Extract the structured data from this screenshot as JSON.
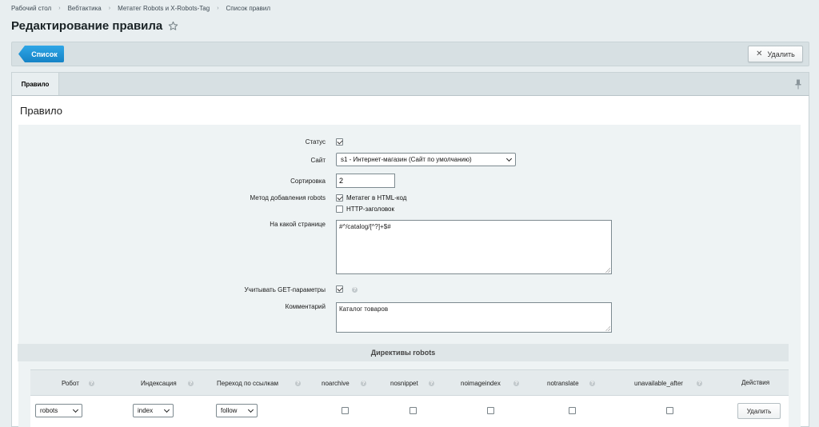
{
  "breadcrumb": [
    "Рабочий стол",
    "Вебтактика",
    "Метатег Robots и X-Robots-Tag",
    "Список правил"
  ],
  "page_title": "Редактирование правила",
  "toolbar": {
    "list_label": "Список",
    "delete_label": "Удалить"
  },
  "tabs": [
    {
      "label": "Правило",
      "active": true
    }
  ],
  "section_heading": "Правило",
  "form": {
    "status_label": "Статус",
    "status_checked": true,
    "site_label": "Сайт",
    "site_value": "s1 - Интернет-магазин (Сайт по умолчанию)",
    "sort_label": "Сортировка",
    "sort_value": "2",
    "method_label": "Метод добавления robots",
    "method_options": [
      {
        "label": "Метатег в HTML-код",
        "checked": true
      },
      {
        "label": "HTTP-заголовок",
        "checked": false
      }
    ],
    "page_label": "На какой странице",
    "page_value": "#^/catalog/[^?]+$#",
    "get_params_label": "Учитывать GET-параметры",
    "get_params_checked": true,
    "comment_label": "Комментарий",
    "comment_value": "Каталог товаров"
  },
  "directives": {
    "title": "Директивы robots",
    "columns": [
      "Робот",
      "Индексация",
      "Переход по ссылкам",
      "noarchive",
      "nosnippet",
      "noimageindex",
      "notranslate",
      "unavailable_after",
      "Действия"
    ],
    "rows": [
      {
        "robot": "robots",
        "index": "index",
        "follow": "follow",
        "noarchive": false,
        "nosnippet": false,
        "noimageindex": false,
        "notranslate": false,
        "unavailable_after": false,
        "action_label": "Удалить"
      }
    ]
  },
  "colors": {
    "accent": "#1f95d8",
    "background": "#e8eef0",
    "panel": "#ffffff",
    "form_bg": "#eef3f4"
  },
  "icons": {
    "title_star": "star-icon",
    "pin": "pin-icon",
    "help": "help-icon",
    "delete": "close-icon"
  }
}
